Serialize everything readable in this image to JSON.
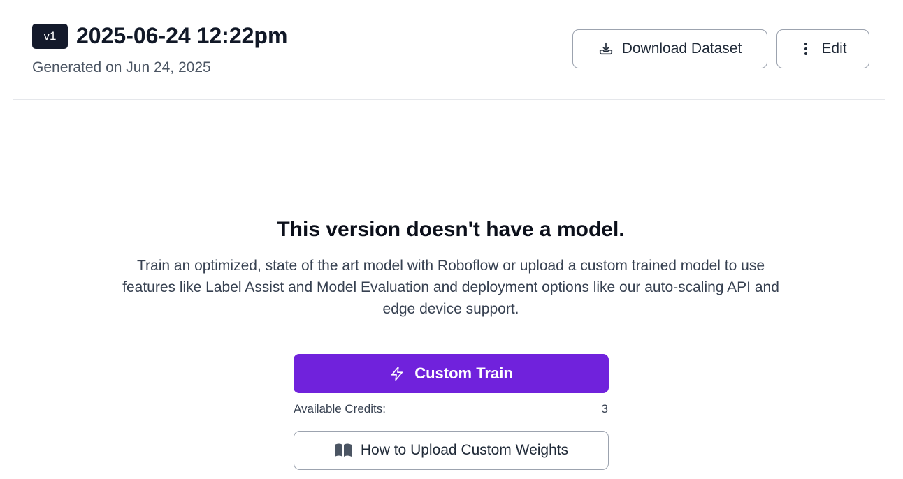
{
  "header": {
    "badge": "v1",
    "title": "2025-06-24 12:22pm",
    "subtitle": "Generated on Jun 24, 2025",
    "download_label": "Download Dataset",
    "edit_label": "Edit"
  },
  "empty_state": {
    "title": "This version doesn't have a model.",
    "description": "Train an optimized, state of the art model with Roboflow or upload a custom trained model to use features like Label Assist and Model Evaluation and deployment options like our auto-scaling API and edge device support.",
    "train_label": "Custom Train",
    "credits_label": "Available Credits:",
    "credits_value": "3",
    "weights_label": "How to Upload Custom Weights"
  },
  "icons": {
    "download": "download-tray-icon",
    "edit": "more-vertical-icon",
    "train": "lightning-bolt-icon",
    "weights": "open-book-icon"
  },
  "colors": {
    "accent": "#7022dc",
    "badge_bg": "#141a2b",
    "border": "#9ca3af"
  }
}
